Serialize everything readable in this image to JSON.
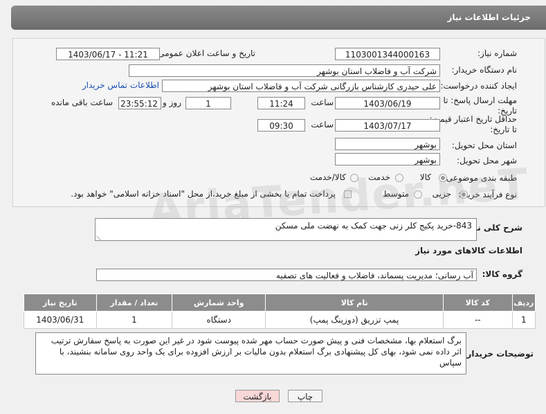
{
  "header": {
    "title": "جزئیات اطلاعات نیاز"
  },
  "form": {
    "need_number_label": "شماره نیاز:",
    "need_number": "1103001344000163",
    "announce_label": "تاریخ و ساعت اعلان عمومی:",
    "announce_value": "1403/06/17 - 11:21",
    "buyer_org_label": "نام دستگاه خریدار:",
    "buyer_org": "شرکت آب و فاضلاب استان بوشهر",
    "creator_label": "ایجاد کننده درخواست:",
    "creator": "علی حیدری کارشناس بازرگانی شرکت آب و فاضلاب استان بوشهر",
    "contact_link": "اطلاعات تماس خریدار",
    "deadline_label": "مهلت ارسال پاسخ: تا تاریخ:",
    "deadline_date": "1403/06/19",
    "time_label": "ساعت",
    "deadline_time": "11:24",
    "days_value": "1",
    "days_label": "روز و",
    "remaining_time": "23:55:12",
    "remaining_label": "ساعت باقی مانده",
    "validity_label": "حداقل تاریخ اعتبار قیمت: تا تاریخ:",
    "validity_date": "1403/07/17",
    "validity_time_label": "ساعت",
    "validity_time": "09:30",
    "province_label": "استان محل تحویل:",
    "province": "بوشهر",
    "city_label": "شهر محل تحویل:",
    "city": "بوشهر",
    "category_label": "طبقه بندی موضوعی:",
    "category_options": [
      "کالا",
      "خدمت",
      "کالا/خدمت"
    ],
    "process_label": "نوع فرآیند خرید :",
    "process_options": [
      "جزیی",
      "متوسط"
    ],
    "payment_note": "پرداخت تمام یا بخشی از مبلغ خرید،از محل \"اسناد خزانه اسلامی\" خواهد بود."
  },
  "description": {
    "label": "شرح کلی نیاز:",
    "value": "843-خرید پکیج کلر زنی جهت کمک به نهضت ملی مسکن"
  },
  "goods_section": {
    "title": "اطلاعات کالاهای مورد نیاز"
  },
  "goods_group": {
    "label": "گروه کالا:",
    "value": "آب رسانی؛ مدیریت پسماند، فاضلاب و فعالیت های تصفیه"
  },
  "table": {
    "headers": [
      "ردیف",
      "کد کالا",
      "نام کالا",
      "واحد شمارش",
      "تعداد / مقدار",
      "تاریخ نیاز"
    ],
    "rows": [
      [
        "1",
        "--",
        "پمپ تزریق (دوزینگ پمپ)",
        "دستگاه",
        "1",
        "1403/06/31"
      ]
    ]
  },
  "buyer_notes": {
    "label": "توضیحات خریدار:",
    "value": "برگ استعلام بها، مشخصات فنی و پیش صورت حساب مهر شده پیوست شود در غیر این صورت به پاسخ سفارش ترتیب اثر داده نمی شود، بهای کل پیشنهادی برگ استعلام بدون مالیات بر ارزش افزوده برای یک واحد روی سامانه بنشیند، با سپاس"
  },
  "buttons": {
    "print": "چاپ",
    "back": "بازگشت"
  },
  "watermark": "AriaTender.neT",
  "colors": {
    "header_bg": "#7a7a7a",
    "link": "#1a4fb3",
    "back_button_bg": "#f8d7d7"
  }
}
